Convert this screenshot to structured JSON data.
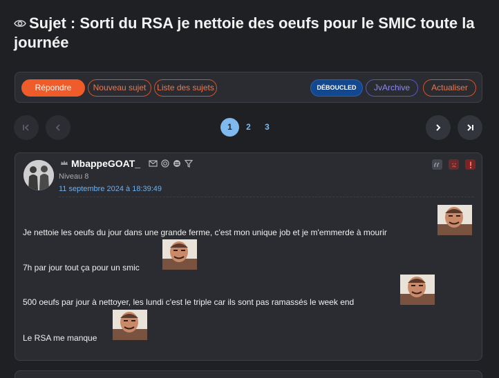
{
  "topic": {
    "title": "Sujet : Sorti du RSA je nettoie des oeufs pour le SMIC toute la journée",
    "icon": "eye-icon"
  },
  "toolbar": {
    "reply": "Répondre",
    "new_topic": "Nouveau sujet",
    "topic_list": "Liste des sujets",
    "deboucled": "DÉBOUCLED",
    "jvarchive": "JvArchive",
    "refresh": "Actualiser"
  },
  "pagination": {
    "pages": [
      "1",
      "2",
      "3"
    ],
    "current": "1"
  },
  "post": {
    "author": "MbappeGOAT_",
    "level": "Niveau 8",
    "date": "11 septembre 2024 à 18:39:49",
    "lines": [
      "Je nettoie les oeufs du jour dans une grande ferme, c'est mon unique job et je m'emmerde à mourir",
      "7h par jour tout ça pour un smic",
      "500 oeufs par jour à nettoyer, les lundi c'est le triple car ils sont pas ramassés le week end",
      "Le RSA me manque"
    ],
    "sticker": "risitas-sticker"
  },
  "colors": {
    "background": "#1f2024",
    "accent": "#f05b2a",
    "link": "#6fb0ee"
  }
}
